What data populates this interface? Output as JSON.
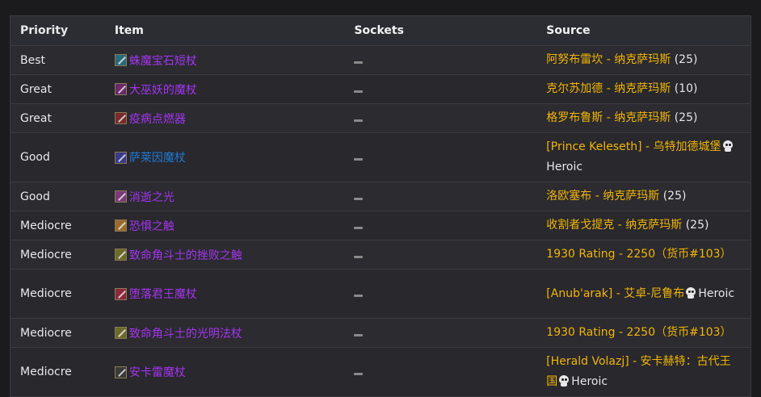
{
  "headers": {
    "priority": "Priority",
    "item": "Item",
    "sockets": "Sockets",
    "source": "Source"
  },
  "rows": [
    {
      "priority": "Best",
      "item": "蛛魔宝石短杖",
      "quality": "epic",
      "icon_color": "#2a6a7a",
      "sockets": "none",
      "source_main": "阿努布雷坎 - 纳克萨玛斯",
      "source_suffix": " (25)",
      "heroic": ""
    },
    {
      "priority": "Great",
      "item": "大巫妖的魔杖",
      "quality": "epic",
      "icon_color": "#6a2a6a",
      "sockets": "none",
      "source_main": "克尔苏加德 - 纳克萨玛斯",
      "source_suffix": " (10)",
      "heroic": ""
    },
    {
      "priority": "Great",
      "item": "疫病点燃器",
      "quality": "epic",
      "icon_color": "#7a2a2a",
      "sockets": "none",
      "source_main": "格罗布鲁斯 - 纳克萨玛斯",
      "source_suffix": " (25)",
      "heroic": ""
    },
    {
      "priority": "Good",
      "item": "萨莱因魔杖",
      "quality": "rare",
      "icon_color": "#3a3a8a",
      "sockets": "none",
      "source_main": "[Prince Keleseth] - 乌特加德城堡",
      "source_suffix": "",
      "heroic": "Heroic"
    },
    {
      "priority": "Good",
      "item": "消逝之光",
      "quality": "epic",
      "icon_color": "#7a3a7a",
      "sockets": "none",
      "source_main": "洛欧塞布 - 纳克萨玛斯",
      "source_suffix": " (25)",
      "heroic": ""
    },
    {
      "priority": "Mediocre",
      "item": "恐惧之触",
      "quality": "epic",
      "icon_color": "#9a6a2a",
      "sockets": "none",
      "source_main": "收割者戈提克 - 纳克萨玛斯",
      "source_suffix": " (25)",
      "heroic": ""
    },
    {
      "priority": "Mediocre",
      "item": "致命角斗士的挫败之触",
      "quality": "epic",
      "icon_color": "#6a6a2a",
      "sockets": "none",
      "source_main": "1930 Rating - 2250",
      "source_suffix": "（货币#103）",
      "heroic": ""
    },
    {
      "priority": "Mediocre",
      "item": "堕落君王魔杖",
      "quality": "epic",
      "icon_color": "#8a2a3a",
      "sockets": "none",
      "source_main": "[Anub'arak] - 艾卓-尼鲁布",
      "source_suffix": "",
      "heroic": "Heroic"
    },
    {
      "priority": "Mediocre",
      "item": "致命角斗士的光明法杖",
      "quality": "epic",
      "icon_color": "#6a6a2a",
      "sockets": "none",
      "source_main": "1930 Rating - 2250",
      "source_suffix": "（货币#103）",
      "heroic": ""
    },
    {
      "priority": "Mediocre",
      "item": "安卡雷魔杖",
      "quality": "epic",
      "icon_color": "#3a3a3a",
      "sockets": "none",
      "source_main": "[Herald Volazj] - 安卡赫特：古代王国",
      "source_suffix": "",
      "heroic": "Heroic"
    }
  ],
  "colors": {
    "epic": "#a335ee",
    "rare": "#1f78d1",
    "source": "#f2b600"
  }
}
